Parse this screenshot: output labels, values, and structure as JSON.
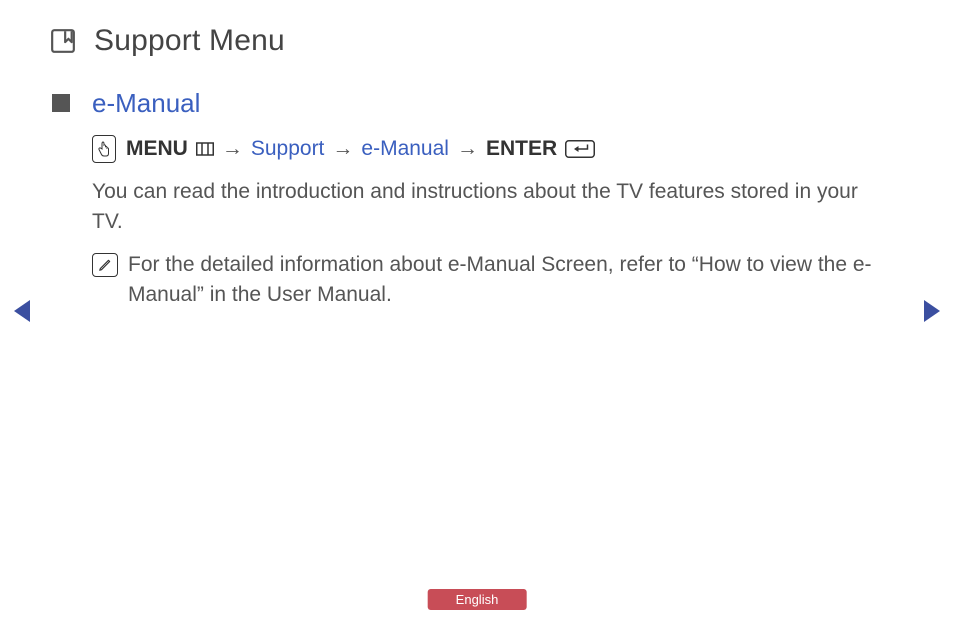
{
  "title": "Support Menu",
  "section": {
    "heading": "e-Manual",
    "breadcrumb": {
      "menu_label": "MENU",
      "arrow": "→",
      "step1": "Support",
      "step2": "e-Manual",
      "enter_label": "ENTER"
    },
    "body": "You can read the introduction and instructions about the TV features stored in your TV.",
    "note": "For the detailed information about e-Manual Screen, refer to “How to view the e-Manual” in the User Manual."
  },
  "footer": {
    "language": "English"
  }
}
